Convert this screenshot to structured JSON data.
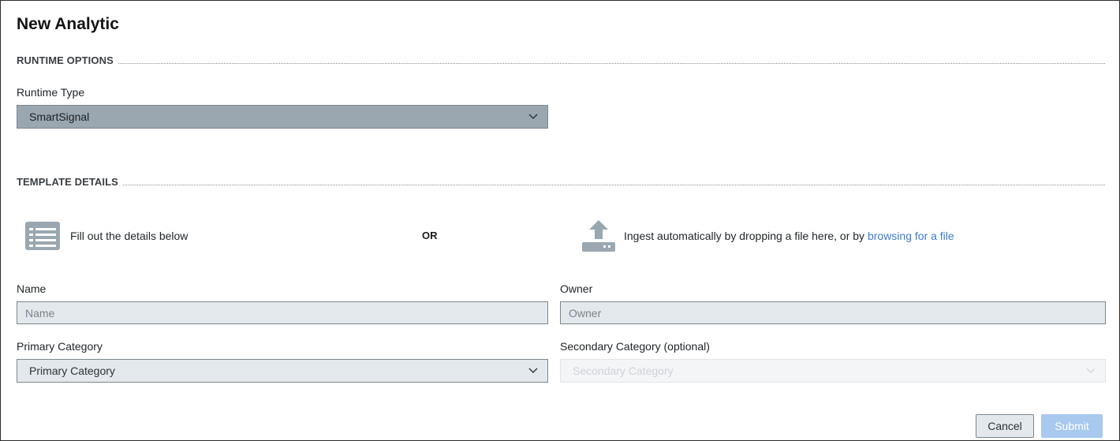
{
  "page": {
    "title": "New Analytic"
  },
  "runtime_options": {
    "section_title": "RUNTIME OPTIONS",
    "runtime_type_label": "Runtime Type",
    "runtime_type_value": "SmartSignal"
  },
  "template_details": {
    "section_title": "TEMPLATE DETAILS",
    "details_option_text": "Fill out the details below",
    "or_text": "OR",
    "ingest_text": "Ingest automatically by dropping a file here, or by ",
    "browse_link": "browsing for a file"
  },
  "form": {
    "name_label": "Name",
    "name_placeholder": "Name",
    "owner_label": "Owner",
    "owner_placeholder": "Owner",
    "primary_category_label": "Primary Category",
    "primary_category_value": "Primary Category",
    "secondary_category_label": "Secondary Category (optional)",
    "secondary_category_value": "Secondary Category"
  },
  "actions": {
    "cancel_label": "Cancel",
    "submit_label": "Submit"
  },
  "icons": {
    "details": "list-form-icon",
    "ingest": "upload-tray-icon",
    "dropdown": "chevron-down-icon"
  },
  "colors": {
    "link": "#3d7bd0",
    "runtime_select_bg": "#9aa7b0",
    "input_bg": "#e3e8ed",
    "submit_disabled": "#a9c9ef"
  }
}
